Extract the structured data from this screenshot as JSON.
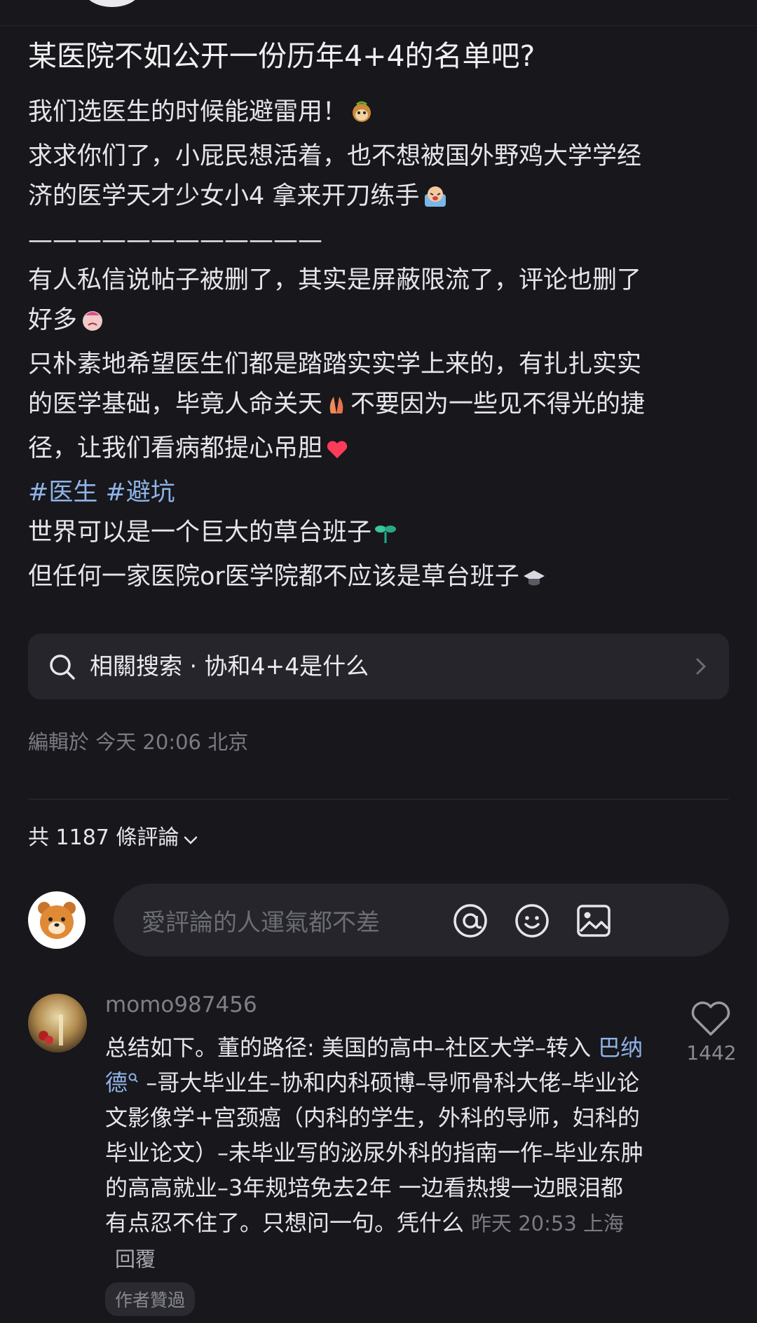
{
  "post": {
    "title": "某医院不如公开一份历年4+4的名单吧?",
    "lines": [
      "我们选医生的时候能避雷用！",
      "求求你们了，小屁民想活着，也不想被国外野鸡大学学经",
      "济的医学天才少女小4 拿来开刀练手",
      "————————————",
      "有人私信说帖子被删了，其实是屏蔽限流了，评论也删了",
      "好多",
      "只朴素地希望医生们都是踏踏实实学上来的，有扎扎实实",
      "的医学基础，毕竟人命关天",
      "不要因为一些见不得光的捷",
      "径，让我们看病都提心吊胆"
    ],
    "hashtags": "#医生 #避坑",
    "lines2": [
      "世界可以是一个巨大的草台班子",
      "但任何一家医院or医学院都不应该是草台班子"
    ],
    "related_search": "相關搜索 · 协和4+4是什么",
    "edited": "編輯於 今天 20:06 北京"
  },
  "comments_header": {
    "count_label": "共 1187 條評論"
  },
  "comment_input": {
    "placeholder": "愛評論的人運氣都不差"
  },
  "comment": {
    "username": "momo987456",
    "text_part1": "总结如下。董的路径: 美国的高中–社区大学–转入 ",
    "link": "巴纳德",
    "text_part2": " –哥大毕业生–协和内科硕博–导师骨科大佬–毕业论文影像学+宫颈癌（内科的学生，外科的导师，妇科的毕业论文）–未毕业写的泌尿外科的指南一作–毕业东肿的高高就业–3年规培免去2年  一边看热搜一边眼泪都有点忍不住了。只想问一句。凭什么",
    "time_location": "昨天 20:53 上海",
    "reply_label": "回覆",
    "likes": "1442",
    "badge": "作者贊過"
  },
  "colors": {
    "background": "#17171c",
    "link": "#8fb3e6",
    "muted": "#7b7b83"
  },
  "icons": [
    "search-icon",
    "chevron-right-icon",
    "chevron-down-icon",
    "at-icon",
    "emoji-icon",
    "image-icon",
    "heart-icon"
  ]
}
